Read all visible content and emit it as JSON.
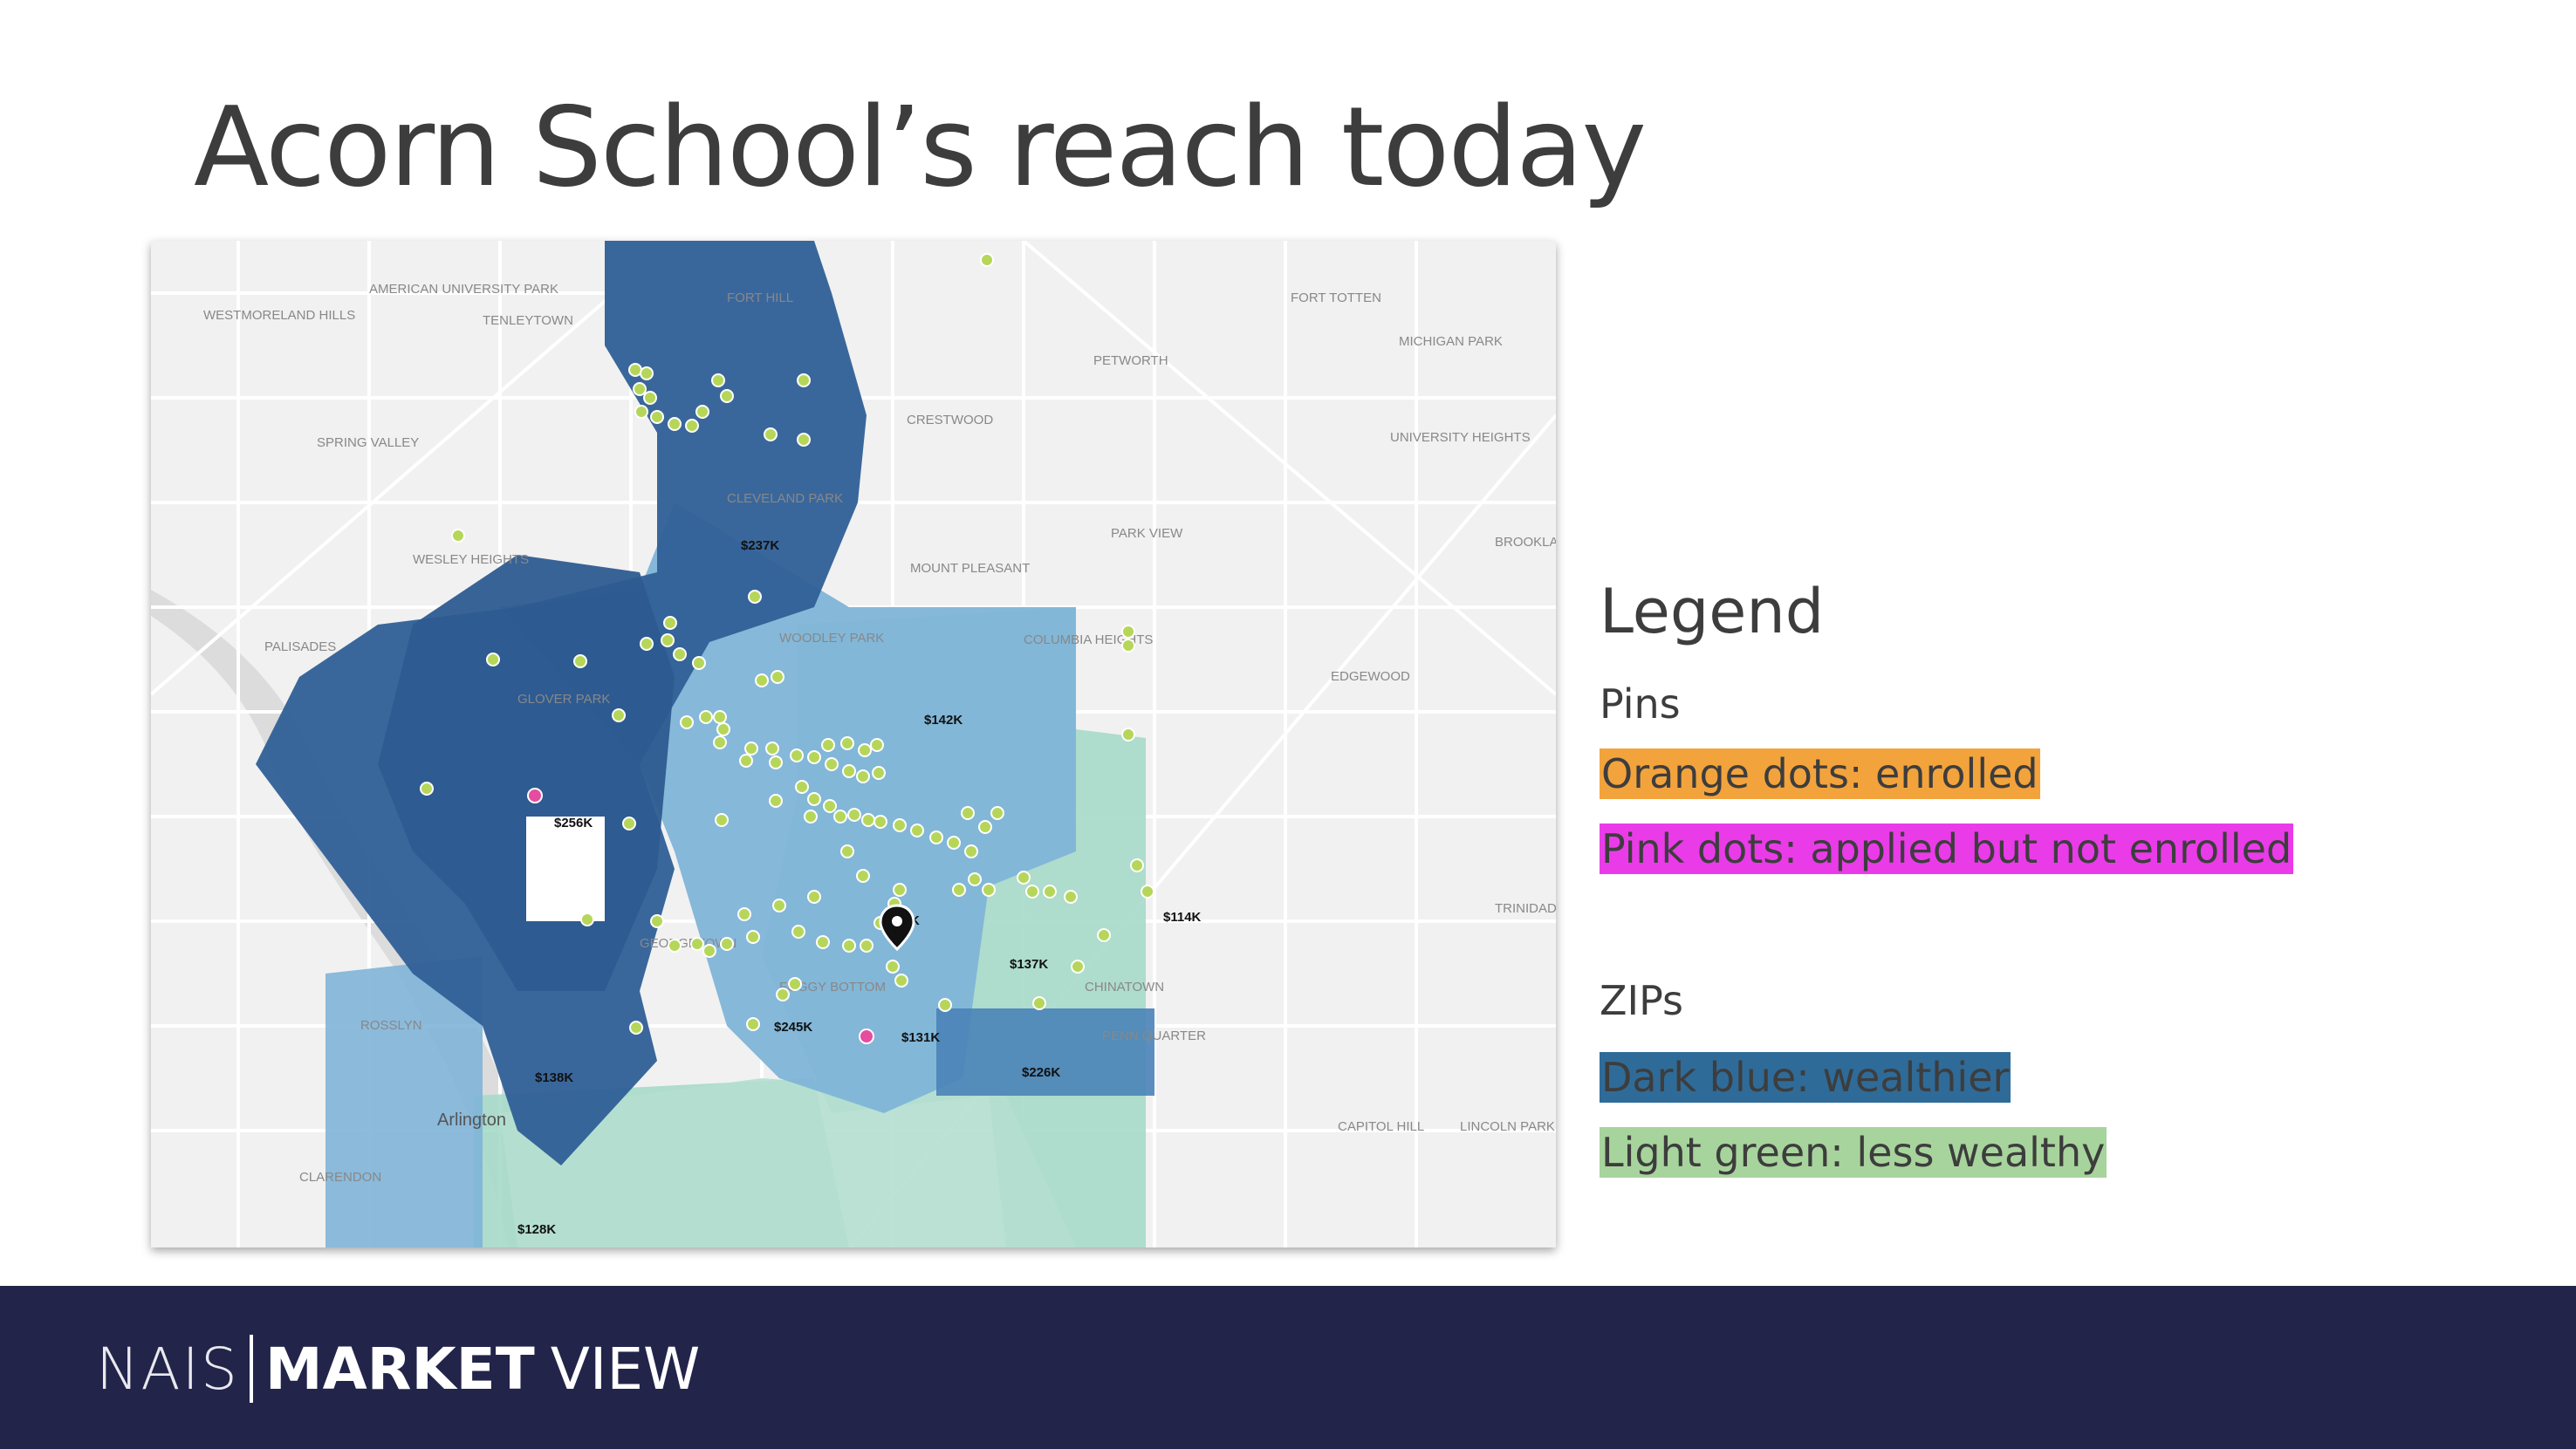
{
  "slide": {
    "title": "Acorn School’s reach today"
  },
  "map": {
    "price_labels": [
      "$237K",
      "$142K",
      "$256K",
      "$114K",
      "$137K",
      "$245K",
      "$131K",
      "$226K",
      "$138K",
      "$128K",
      "K"
    ],
    "place_labels": [
      "Arlington",
      "CLEVELAND PARK",
      "MOUNT PLEASANT",
      "GEORGETOWN",
      "PETWORTH",
      "TENLEYTOWN",
      "SPRING VALLEY",
      "PALISADES",
      "CLARENDON",
      "CRESTWOOD",
      "FORT TOTTEN",
      "MICHIGAN PARK",
      "UNIVERSITY HEIGHTS",
      "EDGEWOOD",
      "BROOKLAND",
      "TRINIDAD",
      "CAPITOL HILL",
      "ROSSLYN",
      "WESLEY HEIGHTS",
      "AMERICAN UNIVERSITY PARK",
      "WESTMORELAND HILLS",
      "PARK VIEW",
      "COLUMBIA HEIGHTS",
      "WOODLEY PARK",
      "GLOVER PARK",
      "FOGGY BOTTOM",
      "PENN QUARTER",
      "CHINATOWN",
      "LINCOLN PARK",
      "FORT HILL"
    ],
    "colors": {
      "dark_blue": "#2f5f96",
      "mid_blue": "#4a83b8",
      "light_blue": "#7fb4d8",
      "light_green": "#a6d9c9",
      "enrolled_dot": "#b6d65a",
      "applied_dot": "#e64ca0"
    }
  },
  "legend": {
    "title": "Legend",
    "pins_heading": "Pins",
    "items_pins": [
      {
        "label": "Orange dots: enrolled",
        "color": "#f3a33c"
      },
      {
        "label": "Pink dots: applied but not enrolled",
        "color": "#ea3be8"
      }
    ],
    "zips_heading": "ZIPs",
    "items_zips": [
      {
        "label": "Dark blue: wealthier",
        "color": "#2f6b98"
      },
      {
        "label": "Light green: less wealthy",
        "color": "#a7d49c"
      }
    ]
  },
  "footer": {
    "brand_left": "NAIS",
    "brand_bold": "MARKET",
    "brand_right": "VIEW"
  }
}
